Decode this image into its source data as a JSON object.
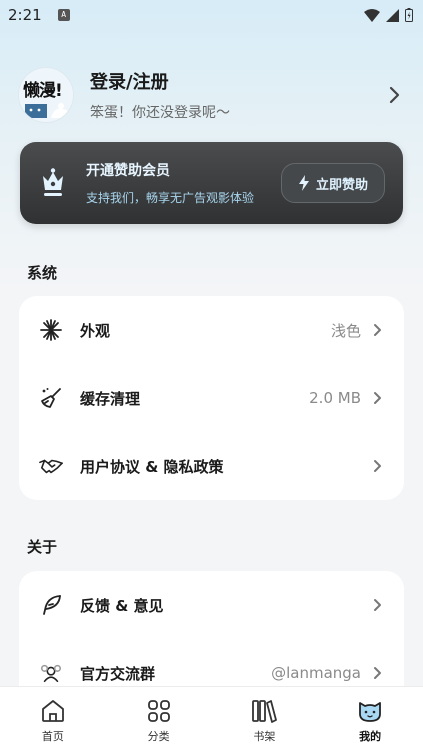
{
  "status_bar": {
    "time": "2:21",
    "notification_icon": "A"
  },
  "profile": {
    "avatar_text": "懒漫!",
    "title": "登录/注册",
    "subtitle": "笨蛋！你还没登录呢～"
  },
  "vip": {
    "title": "开通赞助会员",
    "subtitle": "支持我们，畅享无广告观影体验",
    "button_label": "立即赞助"
  },
  "system": {
    "title": "系统",
    "items": [
      {
        "label": "外观",
        "value": "浅色",
        "icon": "appearance-icon"
      },
      {
        "label": "缓存清理",
        "value": "2.0 MB",
        "icon": "broom-icon"
      },
      {
        "label": "用户协议 & 隐私政策",
        "value": "",
        "icon": "handshake-icon"
      }
    ]
  },
  "about": {
    "title": "关于",
    "items": [
      {
        "label": "反馈 & 意见",
        "value": "",
        "icon": "feather-icon"
      },
      {
        "label": "官方交流群",
        "value": "@lanmanga",
        "icon": "group-icon"
      }
    ]
  },
  "tabs": [
    {
      "label": "首页",
      "icon": "home-icon",
      "active": false
    },
    {
      "label": "分类",
      "icon": "category-icon",
      "active": false
    },
    {
      "label": "书架",
      "icon": "bookshelf-icon",
      "active": false
    },
    {
      "label": "我的",
      "icon": "cat-face-icon",
      "active": true
    }
  ],
  "colors": {
    "accent": "#4ea8d8",
    "vip_card": "#3a3c3e",
    "background": "#f4f5f7"
  }
}
